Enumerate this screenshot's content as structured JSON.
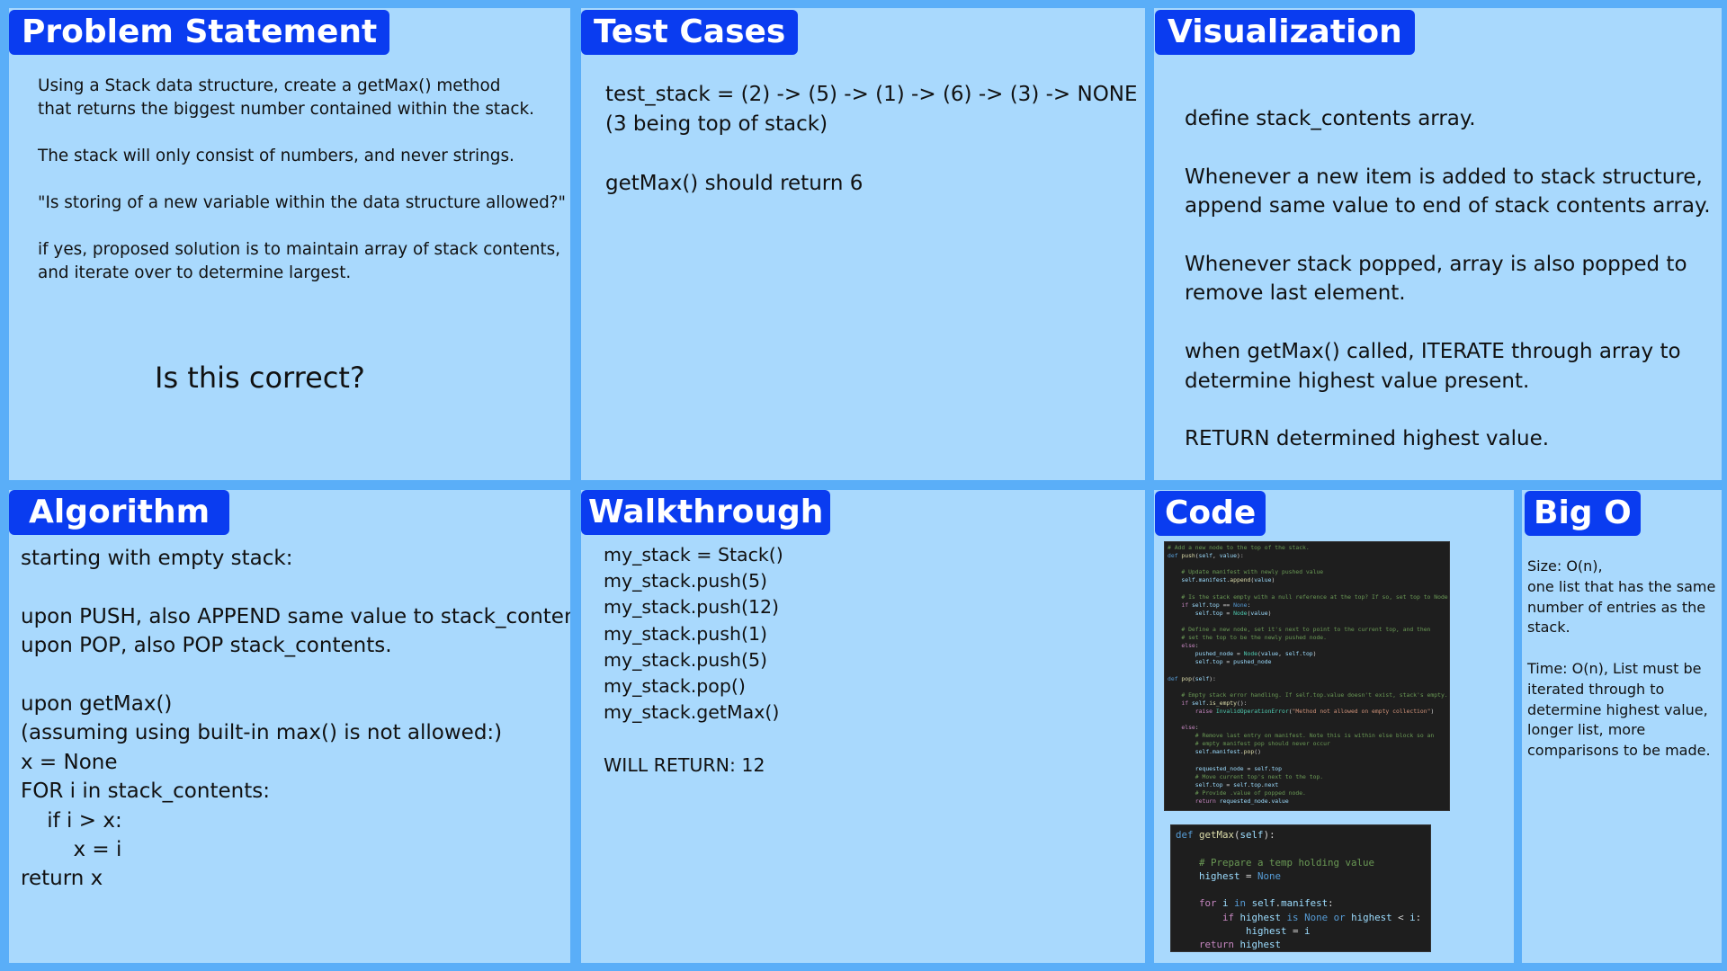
{
  "problem": {
    "header": "Problem Statement",
    "lines": [
      "Using a Stack data structure, create a getMax() method",
      "that returns the biggest number contained within the stack.",
      "",
      "The stack will only consist of numbers, and never strings.",
      "",
      "\"Is storing of a new variable within the data structure allowed?\"",
      "",
      "if yes, proposed solution is to maintain array of stack contents,",
      "and iterate over to determine largest."
    ],
    "question": "Is this correct?"
  },
  "tests": {
    "header": "Test Cases",
    "lines": [
      "test_stack = (2) -> (5) -> (1) -> (6) -> (3) -> NONE",
      "(3 being top of stack)",
      "",
      "getMax() should return 6"
    ]
  },
  "visual": {
    "header": "Visualization",
    "lines": [
      "define stack_contents array.",
      "",
      "Whenever a new item is added to stack structure,",
      "append same value to end of stack contents array.",
      "",
      "Whenever stack popped, array is also popped to",
      "remove last element.",
      "",
      "when getMax() called, ITERATE through array to",
      "determine highest value present.",
      "",
      "RETURN determined highest value."
    ]
  },
  "algo": {
    "header": "Algorithm",
    "lines": [
      "starting with empty stack:",
      "",
      "upon PUSH, also APPEND same value to stack_contents",
      "upon POP, also POP stack_contents.",
      "",
      "upon getMax()",
      "(assuming using built-in max() is not allowed:)",
      "x = None",
      "FOR i in stack_contents:",
      "    if i > x:",
      "        x = i",
      "return x"
    ]
  },
  "walk": {
    "header": "Walkthrough",
    "lines": [
      "my_stack = Stack()",
      "my_stack.push(5)",
      "my_stack.push(12)",
      "my_stack.push(1)",
      "my_stack.push(5)",
      "my_stack.pop()",
      "my_stack.getMax()",
      "",
      "WILL RETURN: 12"
    ]
  },
  "code": {
    "header": "Code",
    "snippet1": [
      [
        [
          "c-com",
          "# Add a new node to the top of the stack."
        ]
      ],
      [
        [
          "c-kw",
          "def "
        ],
        [
          "c-fn",
          "push"
        ],
        [
          "c-op",
          "("
        ],
        [
          "c-var",
          "self"
        ],
        [
          "c-op",
          ", "
        ],
        [
          "c-var",
          "value"
        ],
        [
          "c-op",
          "):"
        ]
      ],
      [
        [
          "c-op",
          ""
        ]
      ],
      [
        [
          "c-com",
          "    # Update manifest with newly pushed value"
        ]
      ],
      [
        [
          "c-op",
          "    "
        ],
        [
          "c-var",
          "self"
        ],
        [
          "c-op",
          "."
        ],
        [
          "c-var",
          "manifest"
        ],
        [
          "c-op",
          "."
        ],
        [
          "c-fn",
          "append"
        ],
        [
          "c-op",
          "("
        ],
        [
          "c-var",
          "value"
        ],
        [
          "c-op",
          ")"
        ]
      ],
      [
        [
          "c-op",
          ""
        ]
      ],
      [
        [
          "c-com",
          "    # Is the stack empty with a null reference at the top? If so, set top to Node."
        ]
      ],
      [
        [
          "c-op",
          "    "
        ],
        [
          "c-kw2",
          "if "
        ],
        [
          "c-var",
          "self"
        ],
        [
          "c-op",
          "."
        ],
        [
          "c-var",
          "top"
        ],
        [
          "c-op",
          " == "
        ],
        [
          "c-kw",
          "None"
        ],
        [
          "c-op",
          ":"
        ]
      ],
      [
        [
          "c-op",
          "        "
        ],
        [
          "c-var",
          "self"
        ],
        [
          "c-op",
          "."
        ],
        [
          "c-var",
          "top"
        ],
        [
          "c-op",
          " = "
        ],
        [
          "c-cls",
          "Node"
        ],
        [
          "c-op",
          "("
        ],
        [
          "c-var",
          "value"
        ],
        [
          "c-op",
          ")"
        ]
      ],
      [
        [
          "c-op",
          ""
        ]
      ],
      [
        [
          "c-com",
          "    # Define a new node, set it's next to point to the current top, and then"
        ]
      ],
      [
        [
          "c-com",
          "    # set the top to be the newly pushed node."
        ]
      ],
      [
        [
          "c-op",
          "    "
        ],
        [
          "c-kw2",
          "else"
        ],
        [
          "c-op",
          ":"
        ]
      ],
      [
        [
          "c-op",
          "        "
        ],
        [
          "c-var",
          "pushed_node"
        ],
        [
          "c-op",
          " = "
        ],
        [
          "c-cls",
          "Node"
        ],
        [
          "c-op",
          "("
        ],
        [
          "c-var",
          "value"
        ],
        [
          "c-op",
          ", "
        ],
        [
          "c-var",
          "self"
        ],
        [
          "c-op",
          "."
        ],
        [
          "c-var",
          "top"
        ],
        [
          "c-op",
          ")"
        ]
      ],
      [
        [
          "c-op",
          "        "
        ],
        [
          "c-var",
          "self"
        ],
        [
          "c-op",
          "."
        ],
        [
          "c-var",
          "top"
        ],
        [
          "c-op",
          " = "
        ],
        [
          "c-var",
          "pushed_node"
        ]
      ],
      [
        [
          "c-op",
          ""
        ]
      ],
      [
        [
          "c-kw",
          "def "
        ],
        [
          "c-fn",
          "pop"
        ],
        [
          "c-op",
          "("
        ],
        [
          "c-var",
          "self"
        ],
        [
          "c-op",
          "):"
        ]
      ],
      [
        [
          "c-op",
          ""
        ]
      ],
      [
        [
          "c-com",
          "    # Empty stack error handling. If self.top.value doesn't exist, stack's empty."
        ]
      ],
      [
        [
          "c-op",
          "    "
        ],
        [
          "c-kw2",
          "if "
        ],
        [
          "c-var",
          "self"
        ],
        [
          "c-op",
          "."
        ],
        [
          "c-fn",
          "is_empty"
        ],
        [
          "c-op",
          "():"
        ]
      ],
      [
        [
          "c-op",
          "        "
        ],
        [
          "c-kw2",
          "raise "
        ],
        [
          "c-cls",
          "InvalidOperationError"
        ],
        [
          "c-op",
          "("
        ],
        [
          "c-str",
          "\"Method not allowed on empty collection\""
        ],
        [
          "c-op",
          ")"
        ]
      ],
      [
        [
          "c-op",
          ""
        ]
      ],
      [
        [
          "c-op",
          "    "
        ],
        [
          "c-kw2",
          "else"
        ],
        [
          "c-op",
          ":"
        ]
      ],
      [
        [
          "c-com",
          "        # Remove last entry on manifest. Note this is within else block so an"
        ]
      ],
      [
        [
          "c-com",
          "        # empty manifest pop should never occur"
        ]
      ],
      [
        [
          "c-op",
          "        "
        ],
        [
          "c-var",
          "self"
        ],
        [
          "c-op",
          "."
        ],
        [
          "c-var",
          "manifest"
        ],
        [
          "c-op",
          "."
        ],
        [
          "c-fn",
          "pop"
        ],
        [
          "c-op",
          "()"
        ]
      ],
      [
        [
          "c-op",
          ""
        ]
      ],
      [
        [
          "c-op",
          "        "
        ],
        [
          "c-var",
          "requested_node"
        ],
        [
          "c-op",
          " = "
        ],
        [
          "c-var",
          "self"
        ],
        [
          "c-op",
          "."
        ],
        [
          "c-var",
          "top"
        ]
      ],
      [
        [
          "c-com",
          "        # Move current top's next to the top."
        ]
      ],
      [
        [
          "c-op",
          "        "
        ],
        [
          "c-var",
          "self"
        ],
        [
          "c-op",
          "."
        ],
        [
          "c-var",
          "top"
        ],
        [
          "c-op",
          " = "
        ],
        [
          "c-var",
          "self"
        ],
        [
          "c-op",
          "."
        ],
        [
          "c-var",
          "top"
        ],
        [
          "c-op",
          "."
        ],
        [
          "c-var",
          "next"
        ]
      ],
      [
        [
          "c-com",
          "        # Provide .value of popped node."
        ]
      ],
      [
        [
          "c-op",
          "        "
        ],
        [
          "c-kw2",
          "return "
        ],
        [
          "c-var",
          "requested_node"
        ],
        [
          "c-op",
          "."
        ],
        [
          "c-var",
          "value"
        ]
      ]
    ],
    "snippet2": [
      [
        [
          "c-kw",
          "def "
        ],
        [
          "c-fn",
          "getMax"
        ],
        [
          "c-op",
          "("
        ],
        [
          "c-var",
          "self"
        ],
        [
          "c-op",
          "):"
        ]
      ],
      [
        [
          "c-op",
          ""
        ]
      ],
      [
        [
          "c-com",
          "    # Prepare a temp holding value"
        ]
      ],
      [
        [
          "c-op",
          "    "
        ],
        [
          "c-var",
          "highest"
        ],
        [
          "c-op",
          " = "
        ],
        [
          "c-kw",
          "None"
        ]
      ],
      [
        [
          "c-op",
          ""
        ]
      ],
      [
        [
          "c-op",
          "    "
        ],
        [
          "c-kw2",
          "for "
        ],
        [
          "c-var",
          "i"
        ],
        [
          "c-kw",
          " in "
        ],
        [
          "c-var",
          "self"
        ],
        [
          "c-op",
          "."
        ],
        [
          "c-var",
          "manifest"
        ],
        [
          "c-op",
          ":"
        ]
      ],
      [
        [
          "c-op",
          "        "
        ],
        [
          "c-kw2",
          "if "
        ],
        [
          "c-var",
          "highest"
        ],
        [
          "c-kw",
          " is "
        ],
        [
          "c-kw",
          "None"
        ],
        [
          "c-kw",
          " or "
        ],
        [
          "c-var",
          "highest"
        ],
        [
          "c-op",
          " < "
        ],
        [
          "c-var",
          "i"
        ],
        [
          "c-op",
          ":"
        ]
      ],
      [
        [
          "c-op",
          "            "
        ],
        [
          "c-var",
          "highest"
        ],
        [
          "c-op",
          " = "
        ],
        [
          "c-var",
          "i"
        ]
      ],
      [
        [
          "c-op",
          "    "
        ],
        [
          "c-kw2",
          "return "
        ],
        [
          "c-var",
          "highest"
        ]
      ]
    ]
  },
  "bigo": {
    "header": "Big O",
    "lines": [
      "Size: O(n),",
      "one list that has the same",
      "number of entries as the",
      "stack.",
      "",
      "Time: O(n), List must be",
      "iterated through to",
      "determine highest value,",
      "longer list, more",
      "comparisons to be made."
    ]
  }
}
